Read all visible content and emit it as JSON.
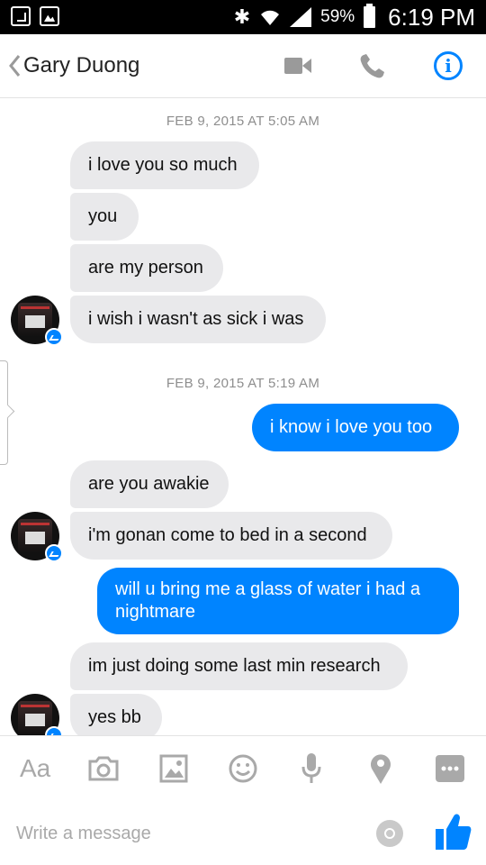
{
  "status_bar": {
    "battery_pct": "59%",
    "time": "6:19 PM"
  },
  "header": {
    "contact_name": "Gary Duong",
    "icons": [
      "back-chevron-icon",
      "video-call-icon",
      "phone-icon",
      "info-icon"
    ],
    "accent_color": "#0084ff"
  },
  "thread": {
    "timestamps": [
      "FEB 9, 2015 AT 5:05 AM",
      "FEB 9, 2015 AT 5:19 AM"
    ],
    "messages": [
      {
        "direction": "in",
        "text": "i love you so much"
      },
      {
        "direction": "in",
        "text": "you"
      },
      {
        "direction": "in",
        "text": "are my person"
      },
      {
        "direction": "in",
        "text": "i wish i wasn't as sick i was"
      },
      {
        "direction": "out",
        "text": "i know i love you too"
      },
      {
        "direction": "in",
        "text": "are you awakie"
      },
      {
        "direction": "in",
        "text": "i'm gonan come to bed in a second"
      },
      {
        "direction": "out",
        "text": "will u bring me a glass of water i had a nightmare"
      },
      {
        "direction": "in",
        "text": "im just doing some last min research"
      },
      {
        "direction": "in",
        "text": "yes bb"
      }
    ],
    "incoming_bubble_color": "#e9e9eb",
    "outgoing_bubble_color": "#0084ff"
  },
  "toolbar": {
    "text_format_label": "Aa",
    "icons": [
      "text-format-icon",
      "camera-icon",
      "gallery-icon",
      "emoji-icon",
      "microphone-icon",
      "location-icon",
      "more-icon"
    ]
  },
  "compose": {
    "placeholder": "Write a message"
  }
}
